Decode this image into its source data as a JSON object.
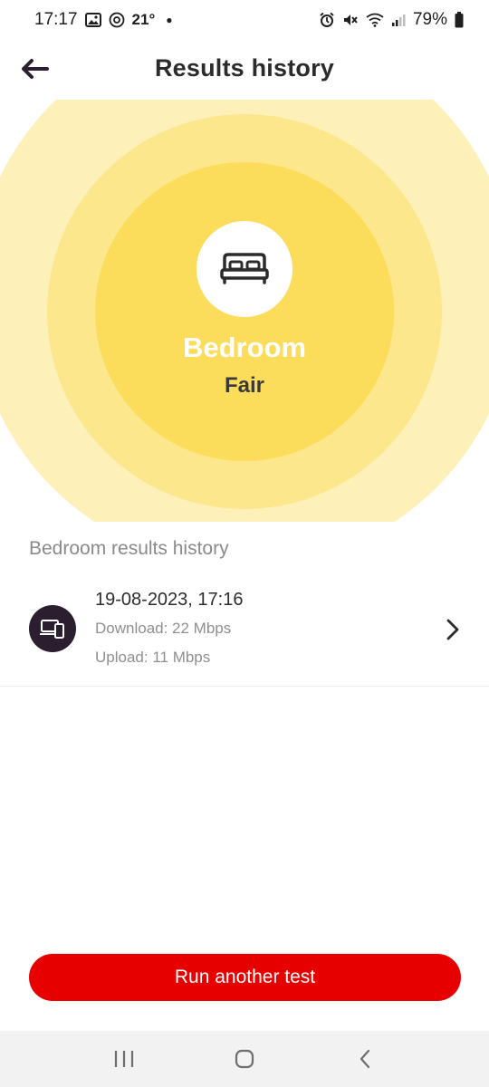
{
  "status_bar": {
    "time": "17:17",
    "temperature": "21°",
    "battery": "79%"
  },
  "header": {
    "title": "Results history"
  },
  "room": {
    "name": "Bedroom",
    "rating": "Fair",
    "icon": "bed-icon"
  },
  "history": {
    "section_title": "Bedroom results history",
    "items": [
      {
        "datetime": "19-08-2023, 17:16",
        "download": "Download: 22 Mbps",
        "upload": "Upload: 11 Mbps",
        "icon": "devices-icon"
      }
    ]
  },
  "actions": {
    "run_label": "Run another test"
  },
  "colors": {
    "accent": "#e60000",
    "ring_outer": "#fdf0b8",
    "ring_middle": "#fde78c",
    "ring_inner": "#fbdc5b",
    "device_icon_bg": "#2b1f2f"
  }
}
